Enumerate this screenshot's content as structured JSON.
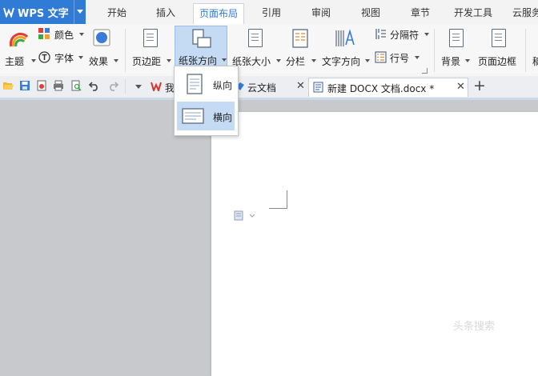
{
  "app": {
    "name": "WPS 文字"
  },
  "menu_tabs": [
    "开始",
    "插入",
    "页面布局",
    "引用",
    "审阅",
    "视图",
    "章节",
    "开发工具",
    "云服务"
  ],
  "active_menu_tab": "页面布局",
  "ribbon": {
    "color_label": "颜色",
    "theme_label": "主题",
    "font_label": "字体",
    "effect_label": "效果",
    "margins_label": "页边距",
    "orientation_label": "纸张方向",
    "size_label": "纸张大小",
    "columns_label": "分栏",
    "text_direction_label": "文字方向",
    "separator_label": "分隔符",
    "line_number_label": "行号",
    "background_label": "背景",
    "page_border_label": "页面边框",
    "cut_label": "稿"
  },
  "orientation_menu": {
    "items": [
      "纵向",
      "横向"
    ],
    "selected": "横向"
  },
  "doc_tabs": {
    "tab1_partial": "我",
    "tab2": "云文档",
    "active": "新建 DOCX 文档.docx *"
  },
  "watermark": "头条搜索",
  "colors": {
    "accent": "#2f7bd6",
    "selected_bg": "#c5daf3"
  }
}
